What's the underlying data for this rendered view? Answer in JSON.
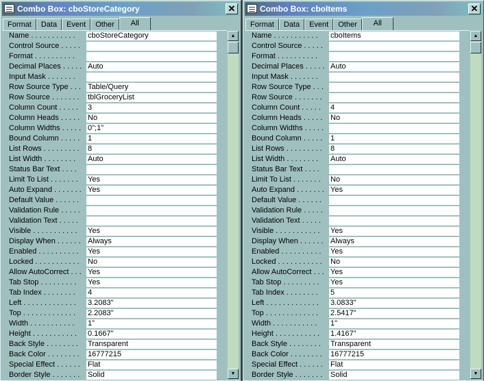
{
  "tabs": [
    "Format",
    "Data",
    "Event",
    "Other",
    "All"
  ],
  "close_label": "✕",
  "left": {
    "title": "Combo Box: cboStoreCategory",
    "rows": [
      [
        "Name . . . . . . . . . . .",
        "cboStoreCategory"
      ],
      [
        "Control Source . . . . .",
        ""
      ],
      [
        "Format . . . . . . . . . .",
        ""
      ],
      [
        "Decimal Places . . . . .",
        "Auto"
      ],
      [
        "Input Mask . . . . . . .",
        ""
      ],
      [
        "Row Source Type . . .",
        "Table/Query"
      ],
      [
        "Row Source . . . . . . .",
        "tblGroceryList"
      ],
      [
        "Column Count . . . . .",
        "3"
      ],
      [
        "Column Heads . . . . .",
        "No"
      ],
      [
        "Column Widths . . . . .",
        "0\";1\""
      ],
      [
        "Bound Column . . . . .",
        "1"
      ],
      [
        "List Rows . . . . . . . . .",
        "8"
      ],
      [
        "List Width . . . . . . . .",
        "Auto"
      ],
      [
        "Status Bar Text . . . .",
        ""
      ],
      [
        "Limit To List . . . . . . .",
        "Yes"
      ],
      [
        "Auto Expand . . . . . . .",
        "Yes"
      ],
      [
        "Default Value . . . . . .",
        ""
      ],
      [
        "Validation Rule . . . . .",
        ""
      ],
      [
        "Validation Text . . . . .",
        ""
      ],
      [
        "Visible . . . . . . . . . . .",
        "Yes"
      ],
      [
        "Display When . . . . . .",
        "Always"
      ],
      [
        "Enabled . . . . . . . . . .",
        "Yes"
      ],
      [
        "Locked . . . . . . . . . . .",
        "No"
      ],
      [
        "Allow AutoCorrect . . .",
        "Yes"
      ],
      [
        "Tab Stop . . . . . . . . .",
        "Yes"
      ],
      [
        "Tab Index . . . . . . . .",
        "4"
      ],
      [
        "Left . . . . . . . . . . . . .",
        "3.2083\""
      ],
      [
        "Top . . . . . . . . . . . . .",
        "2.2083\""
      ],
      [
        "Width . . . . . . . . . . .",
        "1\""
      ],
      [
        "Height . . . . . . . . . . .",
        "0.1667\""
      ],
      [
        "Back Style . . . . . . . .",
        "Transparent"
      ],
      [
        "Back Color . . . . . . . .",
        "16777215"
      ],
      [
        "Special Effect . . . . . .",
        "Flat"
      ],
      [
        "Border Style . . . . . . .",
        "Solid"
      ]
    ]
  },
  "right": {
    "title": "Combo Box: cboItems",
    "rows": [
      [
        "Name . . . . . . . . . . .",
        "cboItems"
      ],
      [
        "Control Source . . . . .",
        ""
      ],
      [
        "Format . . . . . . . . . .",
        ""
      ],
      [
        "Decimal Places . . . . .",
        "Auto"
      ],
      [
        "Input Mask . . . . . . .",
        ""
      ],
      [
        "Row Source Type . . .",
        ""
      ],
      [
        "Row Source . . . . . . .",
        ""
      ],
      [
        "Column Count . . . . .",
        "4"
      ],
      [
        "Column Heads . . . . .",
        "No"
      ],
      [
        "Column Widths . . . . .",
        ""
      ],
      [
        "Bound Column . . . . .",
        "1"
      ],
      [
        "List Rows . . . . . . . . .",
        "8"
      ],
      [
        "List Width . . . . . . . .",
        "Auto"
      ],
      [
        "Status Bar Text . . . .",
        ""
      ],
      [
        "Limit To List . . . . . . .",
        "No"
      ],
      [
        "Auto Expand . . . . . . .",
        "Yes"
      ],
      [
        "Default Value . . . . . .",
        ""
      ],
      [
        "Validation Rule . . . . .",
        ""
      ],
      [
        "Validation Text . . . . .",
        ""
      ],
      [
        "Visible . . . . . . . . . . .",
        "Yes"
      ],
      [
        "Display When . . . . . .",
        "Always"
      ],
      [
        "Enabled . . . . . . . . . .",
        "Yes"
      ],
      [
        "Locked . . . . . . . . . . .",
        "No"
      ],
      [
        "Allow AutoCorrect . . .",
        "Yes"
      ],
      [
        "Tab Stop . . . . . . . . .",
        "Yes"
      ],
      [
        "Tab Index . . . . . . . .",
        "5"
      ],
      [
        "Left . . . . . . . . . . . . .",
        "3.0833\""
      ],
      [
        "Top . . . . . . . . . . . . .",
        "2.5417\""
      ],
      [
        "Width . . . . . . . . . . .",
        "1\""
      ],
      [
        "Height . . . . . . . . . . .",
        "1.4167\""
      ],
      [
        "Back Style . . . . . . . .",
        "Transparent"
      ],
      [
        "Back Color . . . . . . . .",
        "16777215"
      ],
      [
        "Special Effect . . . . . .",
        "Flat"
      ],
      [
        "Border Style . . . . . . .",
        "Solid"
      ]
    ]
  }
}
